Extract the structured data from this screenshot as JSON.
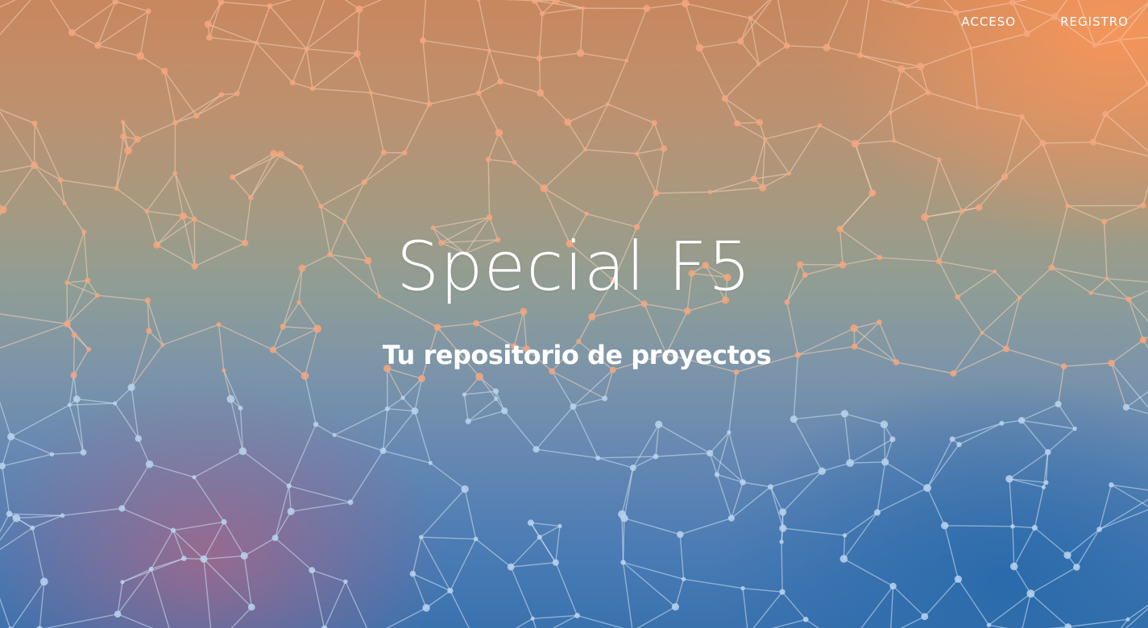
{
  "nav": {
    "items": [
      {
        "label": "ACCESO"
      },
      {
        "label": "REGISTRO"
      }
    ]
  },
  "hero": {
    "title": "Special F5",
    "subtitle": "Tu repositorio de proyectos",
    "background_image": "network-mesh-gradient"
  },
  "colors": {
    "text": "#ffffff",
    "gradient_top": "#c8875e",
    "gradient_mid": "#8f9d95",
    "gradient_bottom": "#3a72ae",
    "mesh_line": "#f6c8a8",
    "mesh_node": "#f4a27a"
  }
}
